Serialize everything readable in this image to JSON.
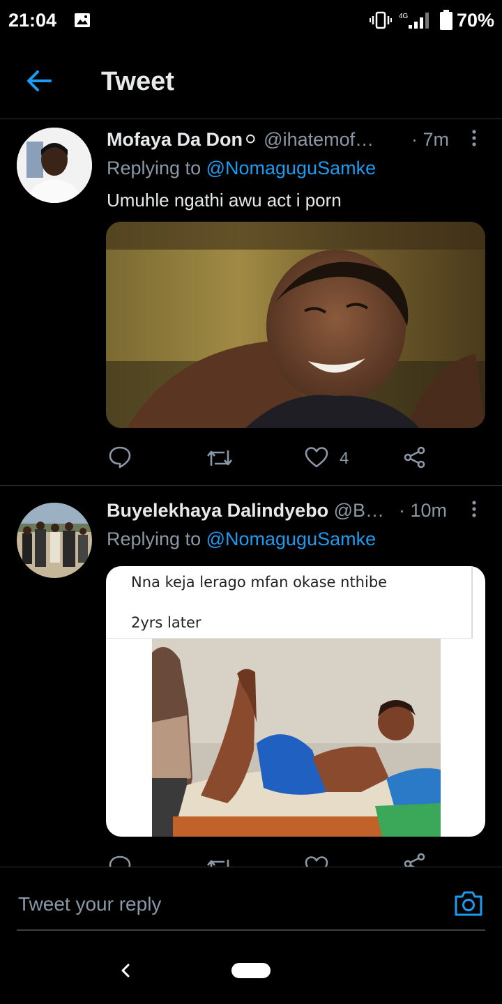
{
  "status_bar": {
    "time": "21:04",
    "network": "4G",
    "battery": "70%",
    "icons": [
      "gallery-icon",
      "vibrate-icon",
      "signal-icon",
      "battery-icon"
    ]
  },
  "header": {
    "title": "Tweet",
    "back_icon": "arrow-left-icon",
    "accent_color": "#1d9bf0"
  },
  "tweets": [
    {
      "author_name": "Mofaya Da Don⚪",
      "handle": "@ihatemof…",
      "time": "· 7m",
      "replying_prefix": "Replying to ",
      "replying_to": "@NomaguguSamke",
      "text": "Umuhle ngathi awu act i porn",
      "like_count": "4"
    },
    {
      "author_name": "Buyelekhaya Dalindyebo",
      "handle": "@B…",
      "time": "· 10m",
      "replying_prefix": "Replying to ",
      "replying_to": "@NomaguguSamke",
      "meme_caption_1": "Nna keja lerago mfan okase nthibe",
      "meme_caption_2": "2yrs later"
    }
  ],
  "reply_bar": {
    "placeholder": "Tweet your reply"
  },
  "colors": {
    "background": "#000000",
    "text_primary": "#e7e9ea",
    "text_secondary": "#8b98a5",
    "divider": "#2f3336"
  }
}
